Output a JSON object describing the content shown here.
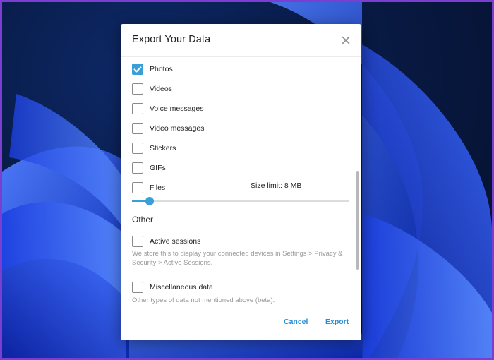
{
  "dialog": {
    "title": "Export Your Data",
    "close_icon": "close-icon"
  },
  "media_options": [
    {
      "label": "Photos",
      "checked": true
    },
    {
      "label": "Videos",
      "checked": false
    },
    {
      "label": "Voice messages",
      "checked": false
    },
    {
      "label": "Video messages",
      "checked": false
    },
    {
      "label": "Stickers",
      "checked": false
    },
    {
      "label": "GIFs",
      "checked": false
    },
    {
      "label": "Files",
      "checked": false
    }
  ],
  "size_limit": {
    "label": "Size limit: 8 MB",
    "slider_fraction": 0.08
  },
  "other": {
    "section_title": "Other",
    "active_sessions": {
      "label": "Active sessions",
      "checked": false,
      "description": "We store this to display your connected devices in Settings > Privacy & Security > Active Sessions."
    },
    "misc_data": {
      "label": "Miscellaneous data",
      "checked": false,
      "description": "Other types of data not mentioned above (beta)."
    }
  },
  "footer": {
    "cancel_label": "Cancel",
    "export_label": "Export"
  },
  "colors": {
    "accent": "#3a9fd6",
    "button_text": "#2c8ccd"
  }
}
